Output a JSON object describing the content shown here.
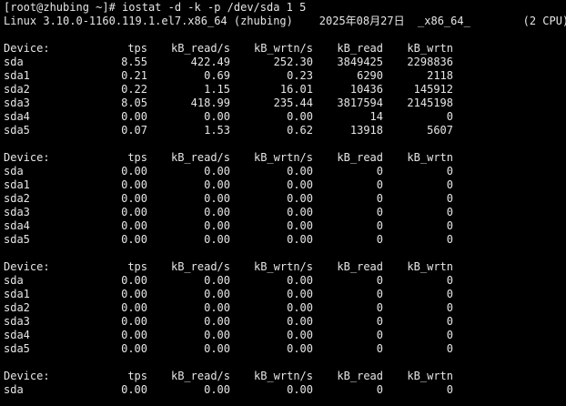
{
  "terminal": {
    "prompt": "[root@zhubing ~]# ",
    "command": "iostat -d -k -p /dev/sda 1 5",
    "sysinfo": "Linux 3.10.0-1160.119.1.el7.x86_64 (zhubing)    2025年08月27日  _x86_64_        (2 CPU)",
    "columns": [
      "Device:",
      "tps",
      "kB_read/s",
      "kB_wrtn/s",
      "kB_read",
      "kB_wrtn"
    ],
    "reports": [
      {
        "rows": [
          [
            "sda",
            "8.55",
            "422.49",
            "252.30",
            "3849425",
            "2298836"
          ],
          [
            "sda1",
            "0.21",
            "0.69",
            "0.23",
            "6290",
            "2118"
          ],
          [
            "sda2",
            "0.22",
            "1.15",
            "16.01",
            "10436",
            "145912"
          ],
          [
            "sda3",
            "8.05",
            "418.99",
            "235.44",
            "3817594",
            "2145198"
          ],
          [
            "sda4",
            "0.00",
            "0.00",
            "0.00",
            "14",
            "0"
          ],
          [
            "sda5",
            "0.07",
            "1.53",
            "0.62",
            "13918",
            "5607"
          ]
        ]
      },
      {
        "rows": [
          [
            "sda",
            "0.00",
            "0.00",
            "0.00",
            "0",
            "0"
          ],
          [
            "sda1",
            "0.00",
            "0.00",
            "0.00",
            "0",
            "0"
          ],
          [
            "sda2",
            "0.00",
            "0.00",
            "0.00",
            "0",
            "0"
          ],
          [
            "sda3",
            "0.00",
            "0.00",
            "0.00",
            "0",
            "0"
          ],
          [
            "sda4",
            "0.00",
            "0.00",
            "0.00",
            "0",
            "0"
          ],
          [
            "sda5",
            "0.00",
            "0.00",
            "0.00",
            "0",
            "0"
          ]
        ]
      },
      {
        "rows": [
          [
            "sda",
            "0.00",
            "0.00",
            "0.00",
            "0",
            "0"
          ],
          [
            "sda1",
            "0.00",
            "0.00",
            "0.00",
            "0",
            "0"
          ],
          [
            "sda2",
            "0.00",
            "0.00",
            "0.00",
            "0",
            "0"
          ],
          [
            "sda3",
            "0.00",
            "0.00",
            "0.00",
            "0",
            "0"
          ],
          [
            "sda4",
            "0.00",
            "0.00",
            "0.00",
            "0",
            "0"
          ],
          [
            "sda5",
            "0.00",
            "0.00",
            "0.00",
            "0",
            "0"
          ]
        ]
      },
      {
        "rows": [
          [
            "sda",
            "0.00",
            "0.00",
            "0.00",
            "0",
            "0"
          ]
        ]
      }
    ]
  },
  "colors": {
    "background": "#000000",
    "foreground": "#e6e6e6"
  }
}
